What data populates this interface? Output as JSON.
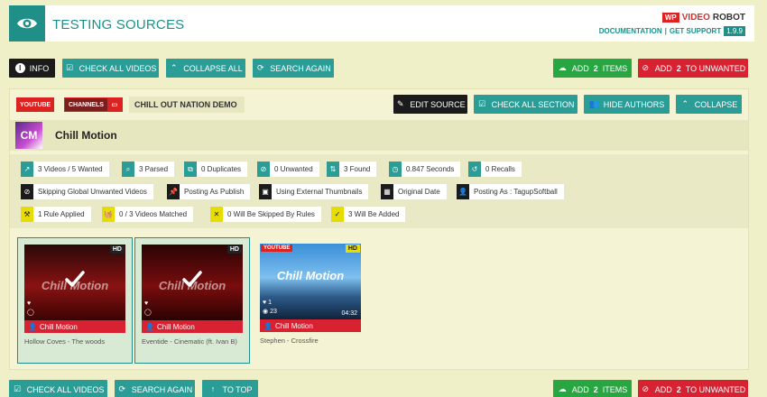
{
  "header": {
    "title": "TESTING SOURCES",
    "brand_prefix": "WP",
    "brand_video": "VIDEO",
    "brand_robot": "ROBOT",
    "documentation": "DOCUMENTATION",
    "separator": "|",
    "support": "GET SUPPORT",
    "version": "1.9.9"
  },
  "toolbar_top": {
    "info": "INFO",
    "check_all_videos": "CHECK ALL VIDEOS",
    "collapse_all": "COLLAPSE ALL",
    "search_again": "SEARCH AGAIN",
    "add_prefix": "ADD",
    "add_count": "2",
    "add_suffix": "ITEMS",
    "unwanted_prefix": "ADD",
    "unwanted_count": "2",
    "unwanted_suffix": "TO UNWANTED"
  },
  "source": {
    "type_tag": "YOUTUBE",
    "kind_tag": "CHANNELS",
    "name": "CHILL OUT NATION DEMO",
    "edit_source": "EDIT SOURCE",
    "check_all_section": "CHECK ALL SECTION",
    "hide_authors": "HIDE AUTHORS",
    "collapse": "COLLAPSE"
  },
  "channel": {
    "avatar_text": "CM",
    "name": "Chill Motion"
  },
  "stats": {
    "wanted": "3 Videos / 5 Wanted",
    "parsed": "3 Parsed",
    "duplicates": "0 Duplicates",
    "unwanted": "0 Unwanted",
    "found": "3 Found",
    "seconds": "0.847 Seconds",
    "recalls": "0 Recalls",
    "skip_global": "Skipping Global Unwanted Videos",
    "posting_publish": "Posting As Publish",
    "external_thumbs": "Using External Thumbnails",
    "original_date": "Original Date",
    "posting_as": "Posting As : TagupSoftball",
    "rule_applied": "1 Rule Applied",
    "matched": "0 / 3 Videos Matched",
    "skipped_rules": "0 Will Be Skipped By Rules",
    "will_be_added": "3 Will Be Added"
  },
  "videos": [
    {
      "title": "Hollow Coves - The woods",
      "channel": "Chill Motion",
      "badge": "HD",
      "logo": "Chill Motion"
    },
    {
      "title": "Eventide - Cinematic (ft. Ivan B)",
      "channel": "Chill Motion",
      "badge": "HD",
      "logo": "Chill Motion"
    },
    {
      "title": "Stephen - Crossfire",
      "channel": "Chill Motion",
      "badge": "HD",
      "yt": "YOUTUBE",
      "logo": "Chill Motion",
      "likes": "1",
      "views": "23",
      "duration": "04:32"
    }
  ],
  "toolbar_bottom": {
    "check_all_videos": "CHECK ALL VIDEOS",
    "search_again": "SEARCH AGAIN",
    "to_top": "TO TOP",
    "add_prefix": "ADD",
    "add_count": "2",
    "add_suffix": "ITEMS",
    "unwanted_prefix": "ADD",
    "unwanted_count": "2",
    "unwanted_suffix": "TO UNWANTED"
  },
  "colors": {
    "teal": "#2a9d96",
    "green": "#27a641",
    "red": "#d82131",
    "yellow": "#e6dc00",
    "background": "#efefc8"
  }
}
